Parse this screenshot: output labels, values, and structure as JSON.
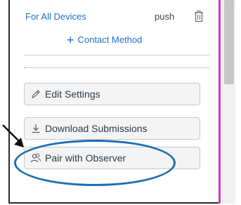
{
  "notification": {
    "device_label": "For All Devices",
    "method": "push",
    "icons": {
      "remove": "trash-icon"
    }
  },
  "contact": {
    "add_label": "Contact Method",
    "plus_glyph": "+"
  },
  "actions": {
    "edit_settings": {
      "label": "Edit Settings",
      "icon": "pencil-icon"
    },
    "download_submissions": {
      "label": "Download Submissions",
      "icon": "download-icon"
    },
    "pair_with_observer": {
      "label": "Pair with Observer",
      "icon": "users-icon"
    }
  },
  "annotation": {
    "highlight": "pair-with-observer-button",
    "color": "#1d6fb3"
  },
  "colors": {
    "link": "#1f6fc5",
    "accent_rule": "#c13bbd",
    "button_bg": "#f4f4f4",
    "button_text": "#2d3b45"
  }
}
